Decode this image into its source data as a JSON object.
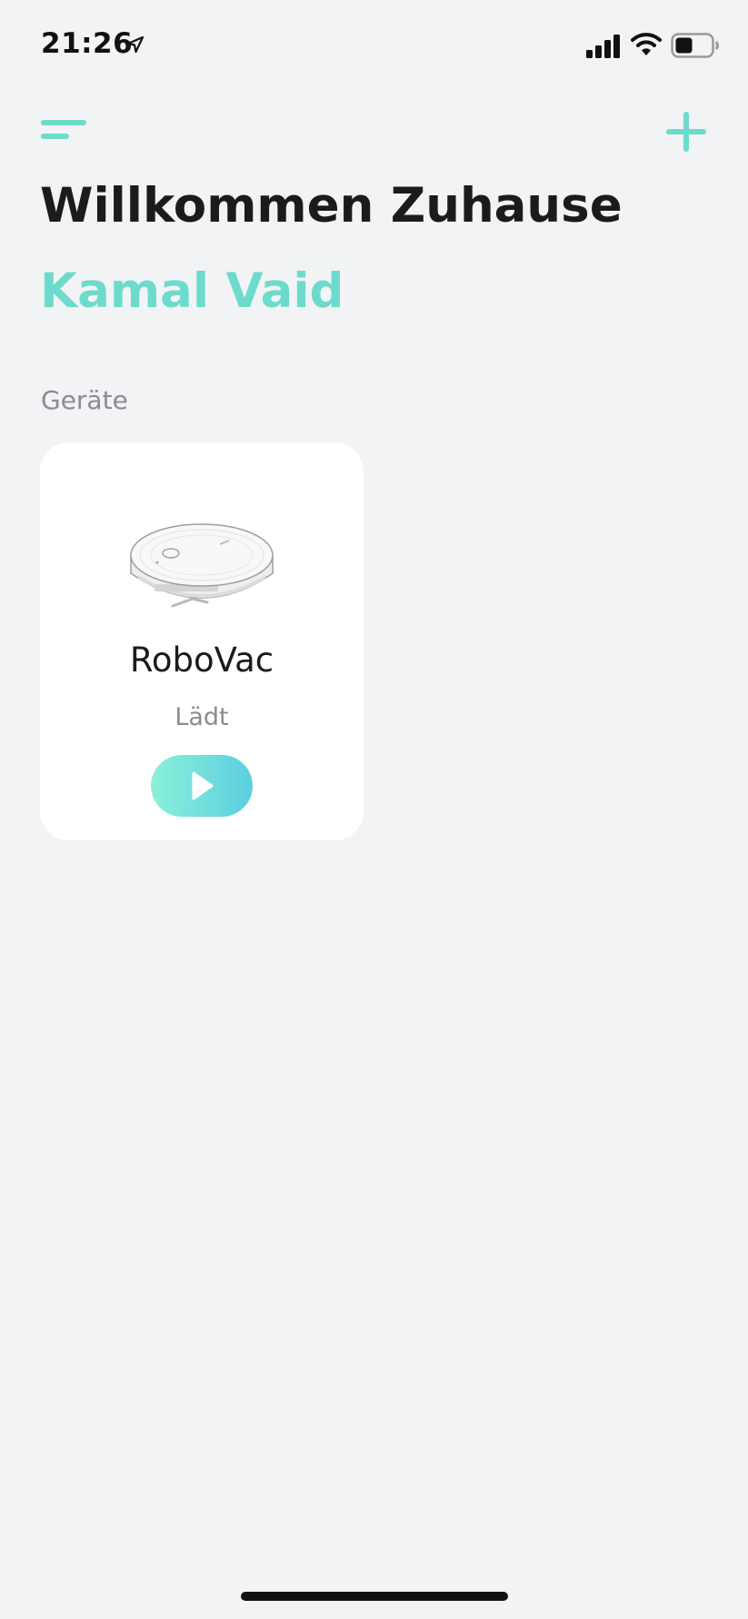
{
  "status_bar": {
    "time": "21:26",
    "icons": [
      "location-arrow-icon",
      "cellular-signal-icon",
      "wifi-icon",
      "battery-icon"
    ],
    "battery_level": 0.45
  },
  "header": {
    "menu_icon": "hamburger-menu-icon",
    "add_icon": "plus-icon",
    "welcome": "Willkommen Zuhause",
    "user_name": "Kamal Vaid"
  },
  "devices": {
    "section_label": "Geräte",
    "items": [
      {
        "name": "RoboVac",
        "status": "Lädt",
        "image": "robot-vacuum-image",
        "action_icon": "play-icon"
      }
    ]
  },
  "colors": {
    "accent": "#6ddbcc",
    "background": "#f2f3f5",
    "card": "#ffffff",
    "text_primary": "#1b1b1d",
    "text_secondary": "#8b8c90",
    "button_gradient_start": "#8af0d9",
    "button_gradient_end": "#5ccfe0"
  }
}
